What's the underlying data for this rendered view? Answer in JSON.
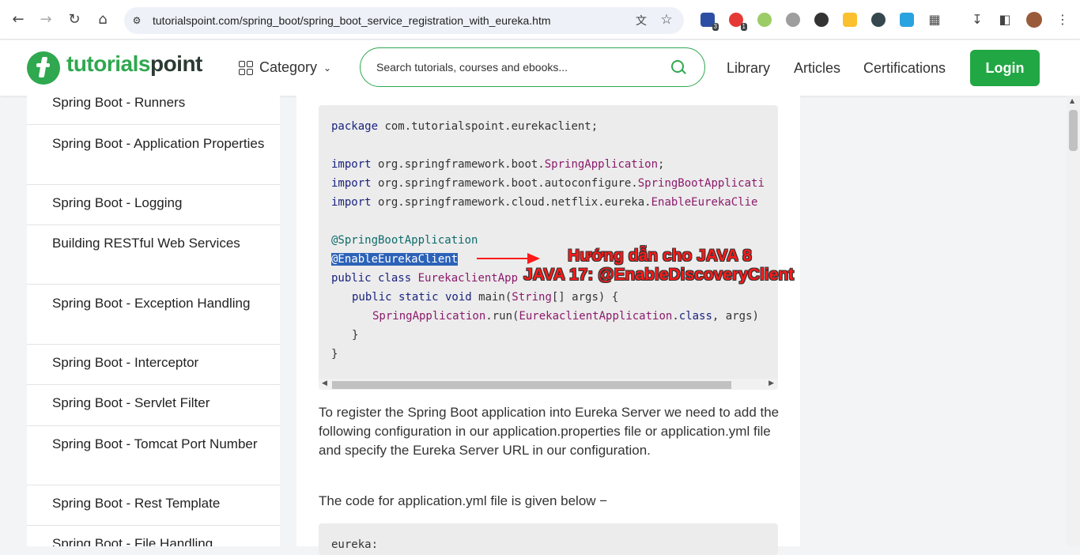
{
  "browser": {
    "url": "tutorialspoint.com/spring_boot/spring_boot_service_registration_with_eureka.htm",
    "extension_badges": [
      "3",
      "1"
    ]
  },
  "header": {
    "logo_prefix": "tutorials",
    "logo_suffix": "point",
    "category_label": "Category",
    "search_placeholder": "Search tutorials, courses and ebooks...",
    "nav": [
      "Library",
      "Articles",
      "Certifications"
    ],
    "login_label": "Login",
    "brand_color": "#2fa84f"
  },
  "sidebar": {
    "items": [
      "Spring Boot - Runners",
      "Spring Boot - Application Properties",
      "Spring Boot - Logging",
      "Building RESTful Web Services",
      "Spring Boot - Exception Handling",
      "Spring Boot - Interceptor",
      "Spring Boot - Servlet Filter",
      "Spring Boot - Tomcat Port Number",
      "Spring Boot - Rest Template",
      "Spring Boot - File Handling"
    ]
  },
  "code": {
    "line1_kw": "package",
    "line1_rest": " com.tutorialspoint.eurekaclient;",
    "import_kw": "import",
    "import1_pkg": " org.springframework.boot.",
    "import1_cls": "SpringApplication",
    "import1_end": ";",
    "import2_pkg": " org.springframework.boot.autoconfigure.",
    "import2_cls": "SpringBootApplicati",
    "import3_pkg": " org.springframework.cloud.netflix.eureka.",
    "import3_cls": "EnableEurekaClie",
    "ann1": "@SpringBootApplication",
    "ann2": "@EnableEurekaClient",
    "class_kw": "public class",
    "class_name": " EurekaclientApp",
    "main_kw": "public static void",
    "main_rest": " main(",
    "main_type": "String",
    "main_end": "[] args) {",
    "run_cls": "SpringApplication",
    "run_mid": ".run(",
    "run_arg": "EurekaclientApplication",
    "run_dot": ".",
    "run_kw": "class",
    "run_end": ", args)",
    "close_inner": "}",
    "close_outer": "}",
    "block2_first": "eureka:"
  },
  "paragraphs": {
    "p1": "To register the Spring Boot application into Eureka Server we need to add the following configuration in our application.properties file or application.yml file and specify the Eureka Server URL in our configuration.",
    "p2": "The code for application.yml file is given below −"
  },
  "annotation": {
    "line1": "Hướng dẫn cho JAVA 8",
    "line2": "JAVA 17: @EnableDiscoveryClient",
    "color": "#ff1a1a"
  }
}
